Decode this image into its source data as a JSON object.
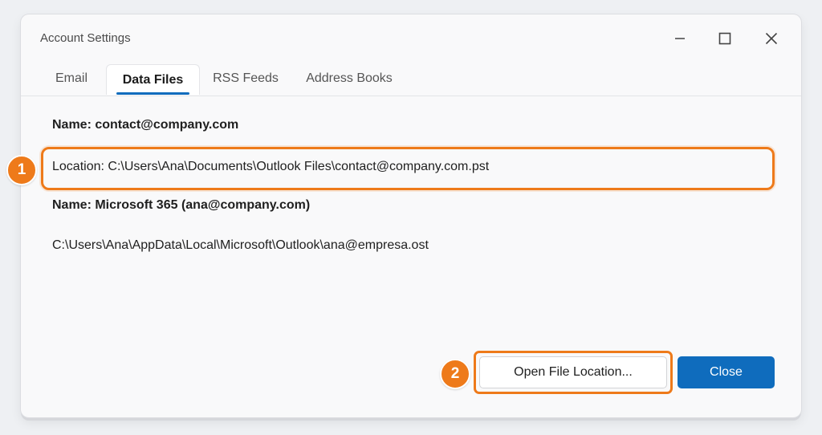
{
  "window": {
    "title": "Account Settings",
    "controls": [
      "minimize-icon",
      "maximize-icon",
      "close-icon"
    ]
  },
  "tabs": [
    {
      "label": "Email",
      "active": false
    },
    {
      "label": "Data Files",
      "active": true
    },
    {
      "label": "RSS Feeds",
      "active": false
    },
    {
      "label": "Address Books",
      "active": false
    }
  ],
  "data_files": [
    {
      "name": "Name: contact@company.com",
      "location": "Location: C:\\Users\\Ana\\Documents\\Outlook Files\\contact@company.com.pst"
    },
    {
      "name": "Name: Microsoft 365 (ana@company.com)",
      "location": "C:\\Users\\Ana\\AppData\\Local\\Microsoft\\Outlook\\ana@empresa.ost"
    }
  ],
  "callouts": [
    "1",
    "2"
  ],
  "buttons": {
    "open_file_location": "Open File Location...",
    "close": "Close"
  },
  "colors": {
    "accent": "#0f6cbd",
    "callout": "#ee7a1a",
    "window_bg": "#f9f9fa",
    "page_bg": "#eef0f3"
  }
}
